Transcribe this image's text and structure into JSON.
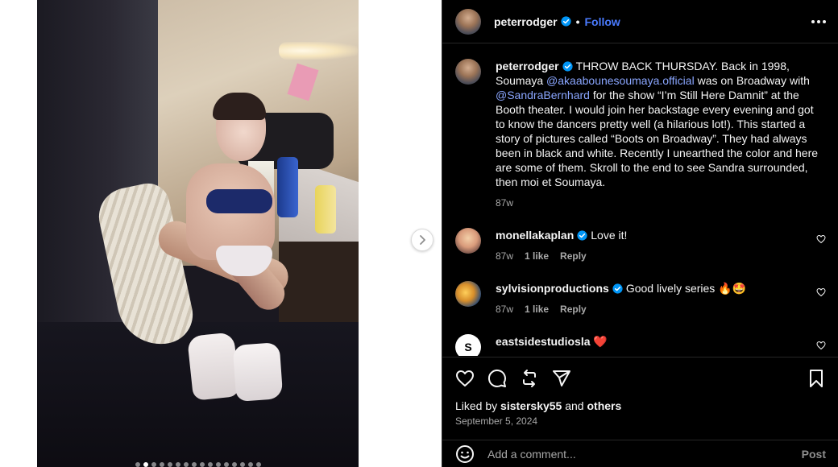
{
  "header": {
    "username": "peterrodger",
    "separator": "•",
    "follow_label": "Follow",
    "more_icon": "more-horizontal-icon"
  },
  "caption": {
    "username": "peterrodger",
    "text_1": "THROW BACK THURSDAY. Back in 1998, Soumaya ",
    "mention_1": "@akaabounesoumaya.official",
    "text_2": " was on Broadway with ",
    "mention_2": "@SandraBernhard",
    "text_3": " for the show “I’m Still Here Damnit” at the Booth theater. I would join her backstage every evening and got to know the dancers pretty well (a hilarious lot!). This started a story of pictures called “Boots on Broadway”. They had always been in black and white. Recently I unearthed the color and here are some of them. Skroll to the end to see Sandra surrounded, then moi et Soumaya.",
    "time": "87w"
  },
  "comments": [
    {
      "username": "monellakaplan",
      "verified": true,
      "text": "Love it!",
      "time": "87w",
      "likes": "1 like",
      "reply_label": "Reply"
    },
    {
      "username": "sylvisionproductions",
      "verified": true,
      "text": "Good lively series 🔥🤩",
      "time": "87w",
      "likes": "1 like",
      "reply_label": "Reply"
    },
    {
      "username": "eastsidestudiosla",
      "verified": false,
      "text": "❤️",
      "avatar_letter": "S"
    }
  ],
  "engagement": {
    "liked_prefix": "Liked by ",
    "liked_user": "sistersky55",
    "liked_and": " and ",
    "liked_others": "others",
    "date": "September 5, 2024"
  },
  "composer": {
    "placeholder": "Add a comment...",
    "post_label": "Post"
  },
  "colors": {
    "panel_bg": "#000000",
    "link_blue": "#4a7bff",
    "mention_blue": "#8aa6ff",
    "verified_blue": "#0095f6",
    "muted": "#a8a8a8"
  },
  "carousel": {
    "slide_count": 16,
    "active_index": 1
  }
}
